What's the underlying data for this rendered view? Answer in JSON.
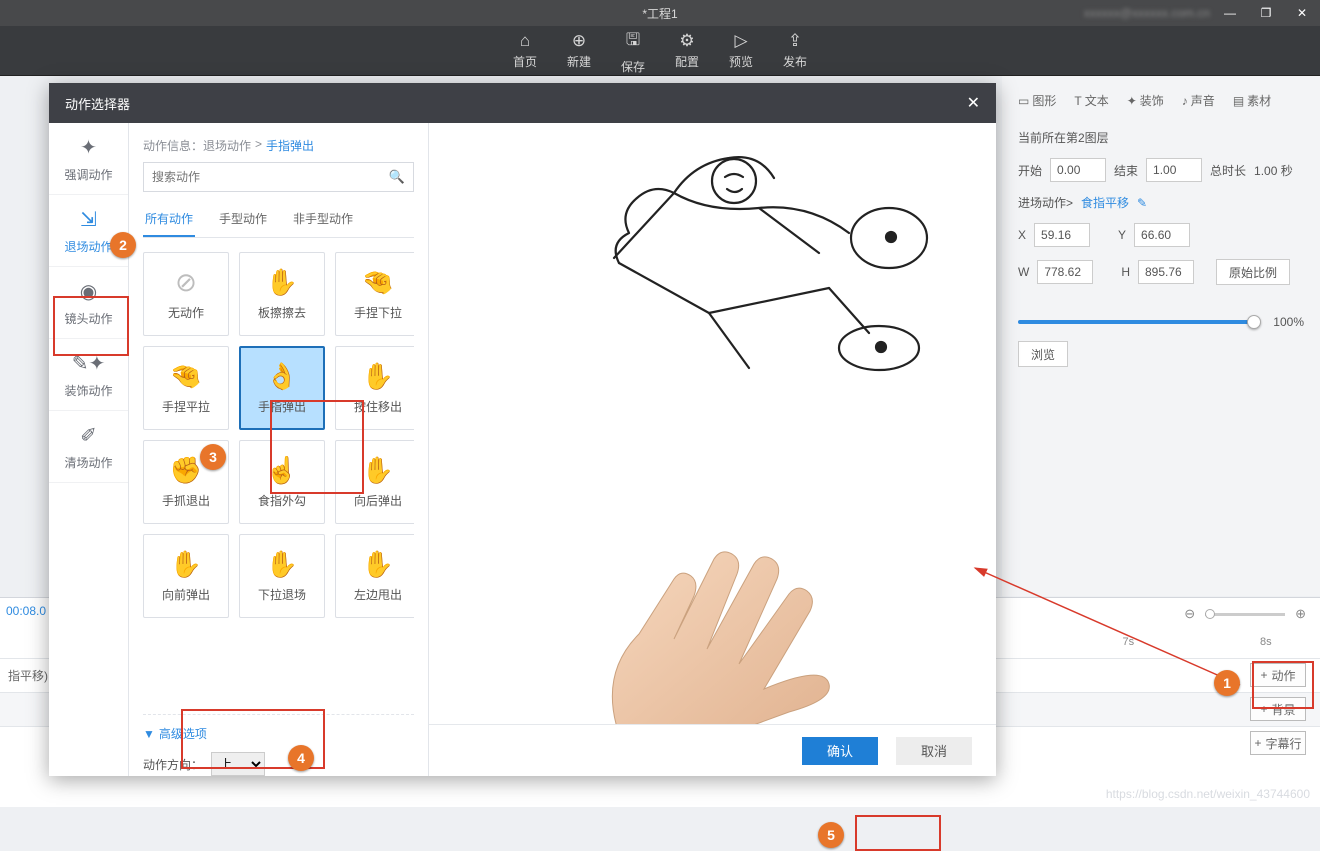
{
  "window": {
    "title": "*工程1",
    "user": "xxxxxx@xxxxxx.com.cn"
  },
  "toolbar": {
    "home": "首页",
    "new": "新建",
    "save": "保存",
    "config": "配置",
    "preview": "预览",
    "publish": "发布"
  },
  "right_tabs": {
    "shape": "图形",
    "text": "文本",
    "decor": "装饰",
    "sound": "声音",
    "asset": "素材"
  },
  "prop": {
    "layer_label": "当前所在第2图层",
    "start_label": "开始",
    "start": "0.00",
    "end_label": "结束",
    "end": "1.00",
    "total_label": "总时长",
    "total": "1.00 秒",
    "enter_label": "进场动作>",
    "enter_name": "食指平移",
    "x_label": "X",
    "x": "59.16",
    "y_label": "Y",
    "y": "66.60",
    "w_label": "W",
    "w": "778.62",
    "h_label": "H",
    "h": "895.76",
    "ratio_btn": "原始比例",
    "opacity_pct": "100%",
    "preview_btn": "浏览"
  },
  "timeline": {
    "time_marks": [
      "7s",
      "8s"
    ],
    "left_time": "00:08.0",
    "row_label_partial": "指平移)",
    "add_action": "动作",
    "add_bg": "背景",
    "add_subtitle": "字幕行"
  },
  "modal": {
    "title": "动作选择器",
    "categories": {
      "emphasis": "强调动作",
      "exit": "退场动作",
      "camera": "镜头动作",
      "decor": "装饰动作",
      "clear": "清场动作"
    },
    "breadcrumb_prefix": "动作信息：退场动作",
    "breadcrumb_current": "手指弹出",
    "search_placeholder": "搜索动作",
    "subtabs": {
      "all": "所有动作",
      "hand": "手型动作",
      "nohand": "非手型动作"
    },
    "cards": [
      "无动作",
      "板擦擦去",
      "手捏下拉",
      "手捏平拉",
      "手指弹出",
      "按住移出",
      "手抓退出",
      "食指外勾",
      "向后弹出",
      "向前弹出",
      "下拉退场",
      "左边甩出"
    ],
    "adv_title": "高级选项",
    "adv_dir_label": "动作方向：",
    "adv_dir_value": "上",
    "ok": "确认",
    "cancel": "取消"
  },
  "watermark": "https://blog.csdn.net/weixin_43744600"
}
